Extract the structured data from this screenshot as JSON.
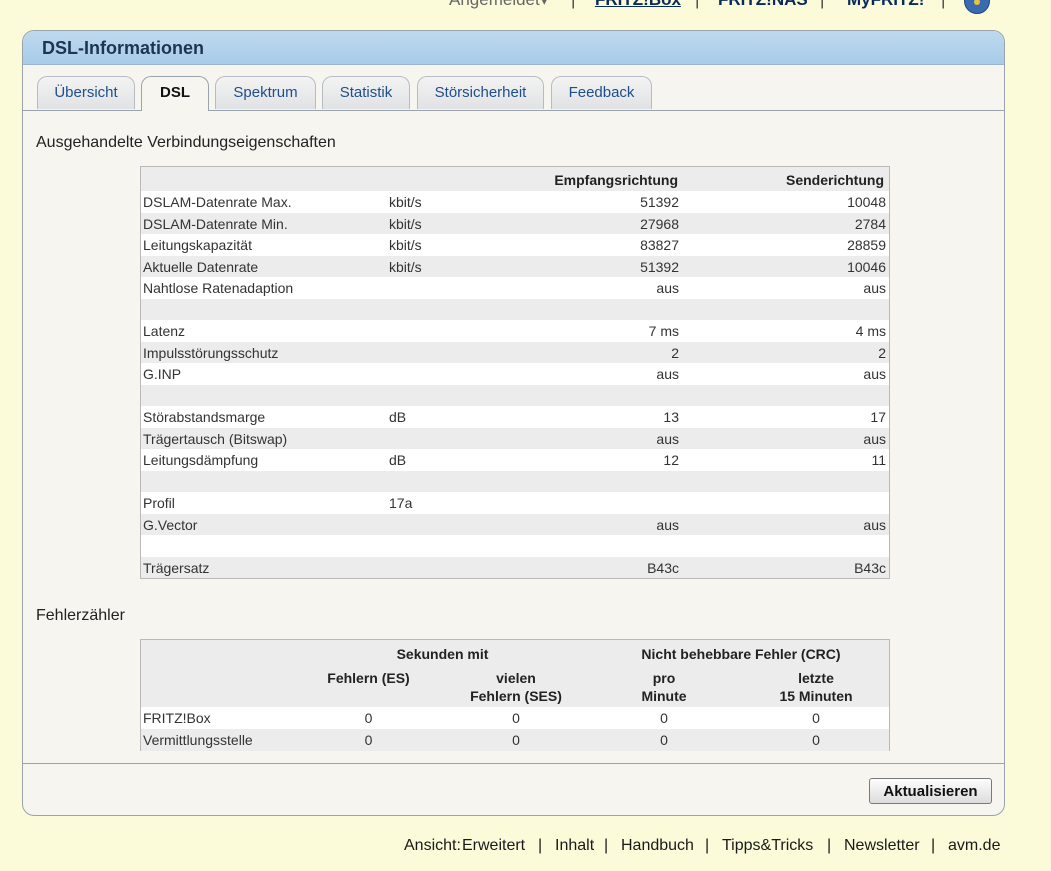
{
  "top_nav": {
    "status": "Angemeldet",
    "status_arrow": "▾",
    "items": [
      "FRITZ!Box",
      "FRITZ!NAS",
      "MyFRITZ!"
    ]
  },
  "panel": {
    "title": "DSL-Informationen"
  },
  "tabs": [
    "Übersicht",
    "DSL",
    "Spektrum",
    "Statistik",
    "Störsicherheit",
    "Feedback"
  ],
  "active_tab": "DSL",
  "connection": {
    "title": "Ausgehandelte Verbindungseigenschaften",
    "headers": {
      "receive": "Empfangsrichtung",
      "send": "Senderichtung"
    },
    "rows": [
      {
        "label": "DSLAM-Datenrate Max.",
        "unit": "kbit/s",
        "rx": "51392",
        "tx": "10048"
      },
      {
        "label": "DSLAM-Datenrate Min.",
        "unit": "kbit/s",
        "rx": "27968",
        "tx": "2784"
      },
      {
        "label": "Leitungskapazität",
        "unit": "kbit/s",
        "rx": "83827",
        "tx": "28859"
      },
      {
        "label": "Aktuelle Datenrate",
        "unit": "kbit/s",
        "rx": "51392",
        "tx": "10046"
      },
      {
        "label": "Nahtlose Ratenadaption",
        "unit": "",
        "rx": "aus",
        "tx": "aus"
      },
      {
        "label": "",
        "unit": "",
        "rx": "",
        "tx": ""
      },
      {
        "label": "Latenz",
        "unit": "",
        "rx": "7 ms",
        "tx": "4 ms"
      },
      {
        "label": "Impulsstörungsschutz",
        "unit": "",
        "rx": "2",
        "tx": "2"
      },
      {
        "label": "G.INP",
        "unit": "",
        "rx": "aus",
        "tx": "aus"
      },
      {
        "label": "",
        "unit": "",
        "rx": "",
        "tx": ""
      },
      {
        "label": "Störabstandsmarge",
        "unit": "dB",
        "rx": "13",
        "tx": "17"
      },
      {
        "label": "Trägertausch (Bitswap)",
        "unit": "",
        "rx": "aus",
        "tx": "aus"
      },
      {
        "label": "Leitungsdämpfung",
        "unit": "dB",
        "rx": "12",
        "tx": "11"
      },
      {
        "label": "",
        "unit": "",
        "rx": "",
        "tx": ""
      },
      {
        "label": "Profil",
        "unit": "17a",
        "rx": "",
        "tx": ""
      },
      {
        "label": "G.Vector",
        "unit": "",
        "rx": "aus",
        "tx": "aus"
      },
      {
        "label": "",
        "unit": "",
        "rx": "",
        "tx": ""
      },
      {
        "label": "Trägersatz",
        "unit": "",
        "rx": "B43c",
        "tx": "B43c"
      }
    ]
  },
  "errors": {
    "title": "Fehlerzähler",
    "group_headers": {
      "seconds": "Sekunden mit",
      "crc": "Nicht behebbare Fehler (CRC)"
    },
    "col_headers": {
      "es": "Fehlern (ES)",
      "ses_1": "vielen",
      "ses_2": "Fehlern (SES)",
      "pm_1": "pro",
      "pm_2": "Minute",
      "l15_1": "letzte",
      "l15_2": "15 Minuten"
    },
    "rows": [
      {
        "label": "FRITZ!Box",
        "es": "0",
        "ses": "0",
        "pm": "0",
        "l15": "0"
      },
      {
        "label": "Vermittlungsstelle",
        "es": "0",
        "ses": "0",
        "pm": "0",
        "l15": "0"
      }
    ]
  },
  "refresh_button": "Aktualisieren",
  "footer": {
    "view_label": "Ansicht:",
    "view_value": "Erweitert",
    "links": [
      "Inhalt",
      "Handbuch",
      "Tipps&Tricks",
      "Newsletter",
      "avm.de"
    ]
  }
}
